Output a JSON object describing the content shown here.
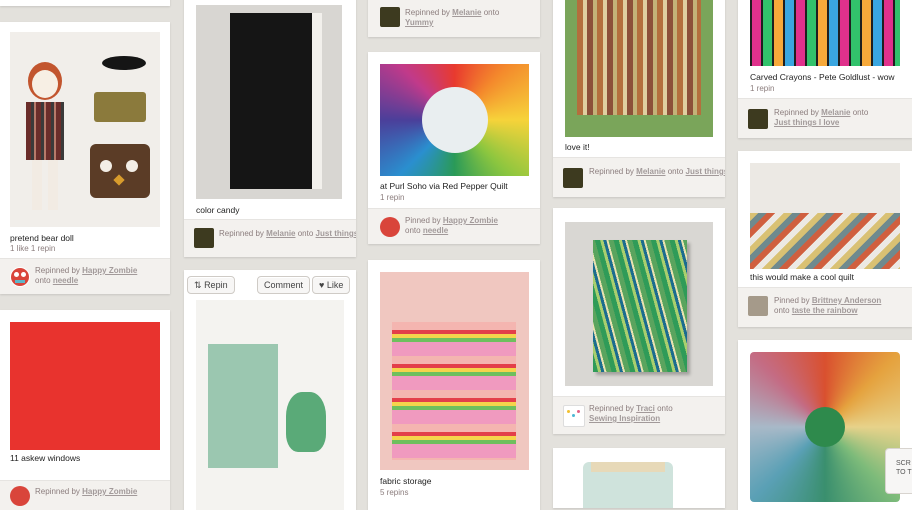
{
  "pins": [
    {
      "description": "pretend bear doll",
      "stats": "1 like  1 repin",
      "action": "Repinned by",
      "user": "Happy Zombie",
      "onto": "onto",
      "board": "needle"
    },
    {
      "description": "11 askew windows",
      "action": "Repinned by",
      "user": "Happy Zombie"
    },
    {
      "description": "color candy",
      "action": "Repinned by",
      "user": "Melanie",
      "onto": "onto",
      "board": "Just things I love"
    },
    {
      "buttons": {
        "repin": "Repin",
        "comment": "Comment",
        "like": "Like"
      }
    },
    {
      "action": "Repinned by",
      "user": "Melanie",
      "onto": "onto",
      "board": "Yummy"
    },
    {
      "description": "at Purl Soho via Red Pepper Quilt",
      "stats": "1 repin",
      "action": "Pinned by",
      "user": "Happy Zombie",
      "onto": "onto",
      "board": "needle"
    },
    {
      "description": "fabric storage",
      "stats": "5 repins"
    },
    {
      "description": "love it!",
      "action": "Repinned by",
      "user": "Melanie",
      "onto": "onto",
      "board": "Just things I love"
    },
    {
      "action": "Repinned by",
      "user": "Traci",
      "onto": "onto",
      "board": "Sewing Inspiration"
    },
    {
      "description": "Carved Crayons - Pete Goldlust - wow",
      "stats": "1 repin",
      "action": "Repinned by",
      "user": "Melanie",
      "onto": "onto",
      "board": "Just things I love"
    },
    {
      "description": "this would make a cool quilt",
      "action": "Pinned by",
      "user": "Brittney Anderson",
      "onto": "onto",
      "board": "taste the rainbow"
    }
  ],
  "scroll_top": {
    "line1": "SCR",
    "line2": "TO T"
  },
  "colors": {
    "background": "#e3e1dc",
    "card": "#ffffff",
    "attribution_bg": "#f3f1ee",
    "link": "#a29a9a",
    "meta": "#8c7e7e"
  }
}
